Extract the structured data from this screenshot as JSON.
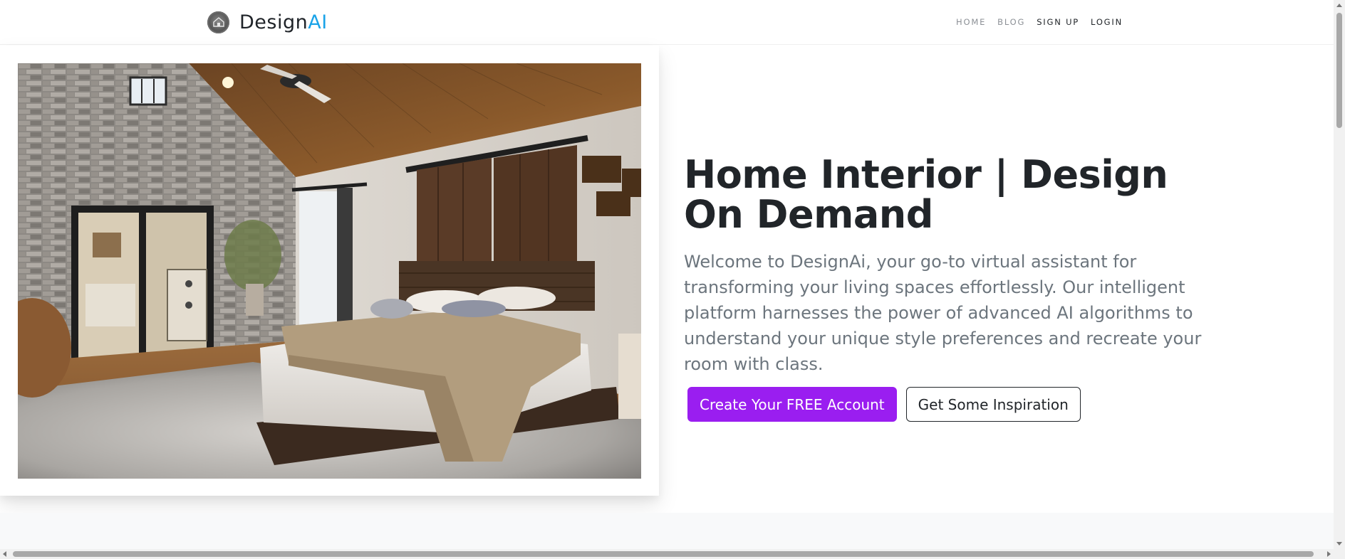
{
  "navbar": {
    "brand_prefix": "Design",
    "brand_suffix": "AI",
    "logo_icon": "house-logo-icon",
    "links": [
      {
        "label": "HOME",
        "style": "muted"
      },
      {
        "label": "BLOG",
        "style": "muted"
      },
      {
        "label": "SIGN UP",
        "style": "strong"
      },
      {
        "label": "LOGIN",
        "style": "strong"
      }
    ]
  },
  "hero": {
    "image_description": "bedroom interior photo",
    "title": "Home Interior | Design On Demand",
    "lead": "Welcome to DesignAi, your go-to virtual assistant for transforming your living spaces effortlessly. Our intelligent platform harnesses the power of advanced AI algorithms to understand your unique style preferences and recreate your room with class.",
    "primary_button": "Create Your FREE Account",
    "secondary_button": "Get Some Inspiration"
  },
  "colors": {
    "brand_accent": "#1aa3e8",
    "primary_button": "#9a1ef0",
    "text_dark": "#212529",
    "text_muted": "#6c757d"
  }
}
